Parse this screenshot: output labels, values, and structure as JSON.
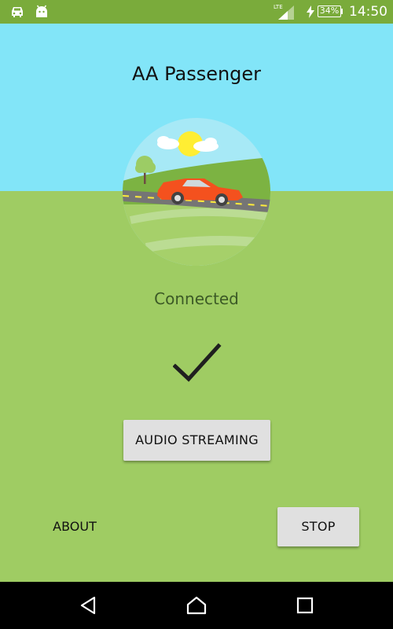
{
  "status_bar": {
    "network_type": "LTE",
    "battery_percent": "34%",
    "time": "14:50",
    "icons": [
      "car-icon",
      "android-icon",
      "signal-icon",
      "charging-icon",
      "battery-icon"
    ]
  },
  "app": {
    "title": "AA Passenger",
    "status": "Connected",
    "status_icon": "checkmark-icon"
  },
  "buttons": {
    "audio_streaming": "AUDIO STREAMING",
    "about": "ABOUT",
    "stop": "STOP"
  },
  "nav_bar": {
    "items": [
      "back-icon",
      "home-icon",
      "recents-icon"
    ]
  },
  "colors": {
    "status_bar": "#7aab3b",
    "sky": "#82e5f8",
    "grass": "#9fcc63",
    "button": "#e0e0e0",
    "car": "#f4511e",
    "sun": "#ffee33"
  }
}
